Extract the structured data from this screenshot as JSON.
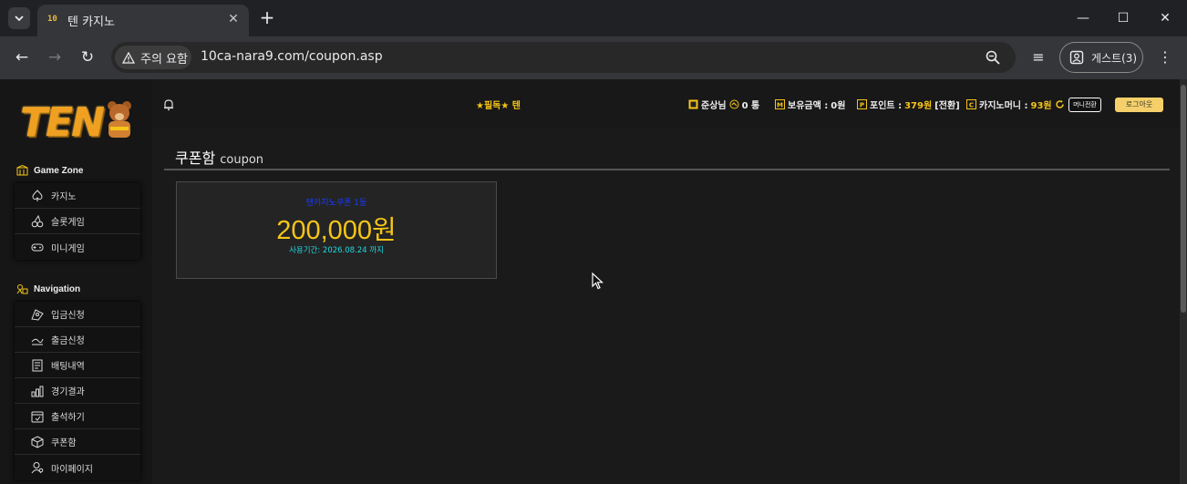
{
  "browser": {
    "tab_title": "텐 카지노",
    "tab_favicon": "10",
    "security_label": "주의 요함",
    "url": "10ca-nara9.com/coupon.asp",
    "guest_label": "게스트(3)"
  },
  "sidebar": {
    "logo_text": "TEN",
    "game_zone_label": "Game Zone",
    "game_items": [
      {
        "label": "카지노",
        "icon": "spade-icon"
      },
      {
        "label": "슬롯게임",
        "icon": "cherry-icon"
      },
      {
        "label": "미니게임",
        "icon": "gamepad-icon"
      }
    ],
    "navigation_label": "Navigation",
    "nav_items": [
      {
        "label": "입금신청",
        "icon": "deposit-icon"
      },
      {
        "label": "출금신청",
        "icon": "withdraw-icon"
      },
      {
        "label": "배팅내역",
        "icon": "betting-history-icon"
      },
      {
        "label": "경기결과",
        "icon": "results-icon"
      },
      {
        "label": "출석하기",
        "icon": "attendance-icon"
      },
      {
        "label": "쿠폰함",
        "icon": "coupon-box-icon"
      },
      {
        "label": "마이페이지",
        "icon": "mypage-icon"
      }
    ]
  },
  "topbar": {
    "marquee": "★필독★ 텐",
    "user_name": "준상님",
    "messages": "0 통",
    "balance_label": "보유금액 :",
    "balance_value": "0원",
    "points_label": "포인트 :",
    "points_value": "379원",
    "points_convert": "[전환]",
    "casino_money_label": "카지노머니 :",
    "casino_money_value": "93원",
    "mini_convert": "머니전환",
    "logout": "로그아웃"
  },
  "main": {
    "title": "쿠폰함",
    "title_sub": "coupon",
    "coupon": {
      "name": "텐카지노쿠폰 1등",
      "amount": "200,000원",
      "expire": "사용기간: 2026.08.24 까지"
    }
  },
  "colors": {
    "accent": "#f5c518",
    "coupon_name": "#1a3cff",
    "coupon_expire": "#22d8e0"
  }
}
